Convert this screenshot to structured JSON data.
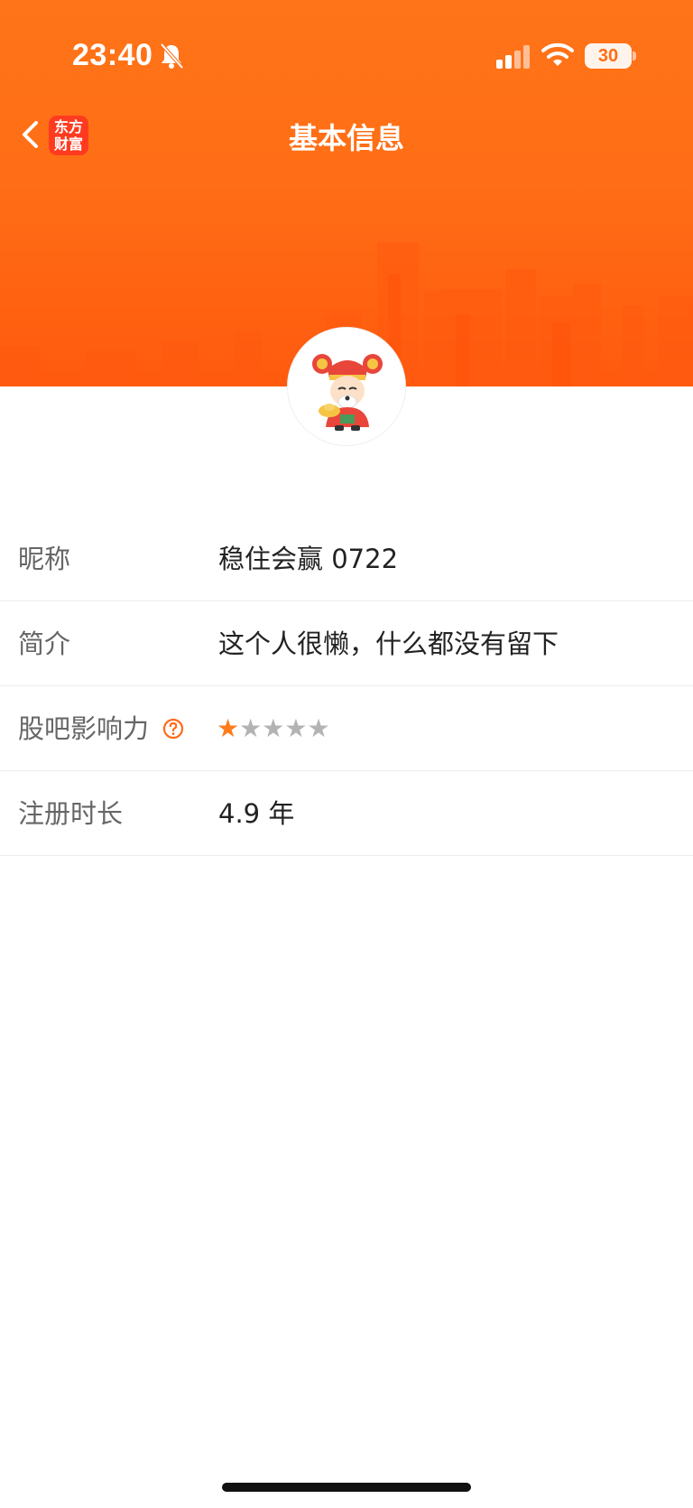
{
  "status_bar": {
    "time": "23:40",
    "battery": "30",
    "icons": [
      "bell-slash-icon",
      "signal-icon",
      "wifi-icon",
      "battery-icon"
    ]
  },
  "nav": {
    "title": "基本信息",
    "logo_line1": "东方",
    "logo_line2": "财富",
    "back_icon": "chevron-left-icon"
  },
  "colors": {
    "header_orange": "#ff6e16",
    "accent_star": "#ff7b1c",
    "label_gray": "#666666"
  },
  "profile": {
    "rows": [
      {
        "label": "昵称",
        "value": "稳住会赢 0722"
      },
      {
        "label": "简介",
        "value": "这个人很懒，什么都没有留下"
      },
      {
        "label": "股吧影响力",
        "rating": 1,
        "rating_max": 5,
        "help_icon": "question-circle-icon"
      },
      {
        "label": "注册时长",
        "value": "4.9 年"
      }
    ]
  }
}
